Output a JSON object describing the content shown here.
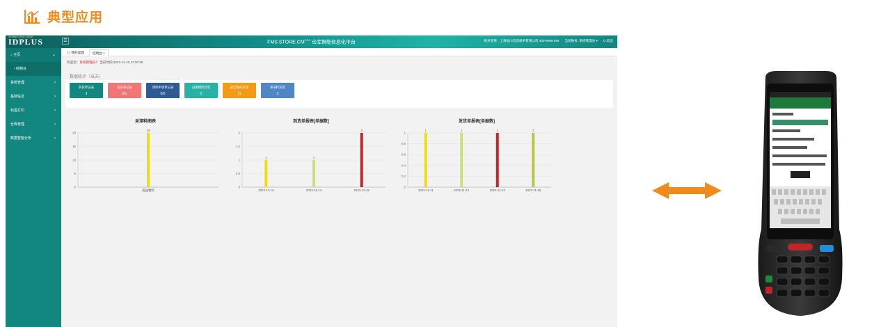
{
  "section": {
    "title": "典型应用",
    "icon": "bar-chart-icon",
    "color": "#f08a1c"
  },
  "app": {
    "logo": "IDPLUS",
    "logo_sub": "INTERNATIONAL GROUP",
    "menu_toggle": "☰",
    "title": "FMS.STORE.CM",
    "version": "V1.0",
    "subtitle": "仓库智能信息化平台",
    "tech_support": "技术支持：上海益川信息技术有限公司 400-6699-049",
    "account_label": "当前账号:",
    "account_name": "系统管理员 ▾",
    "logout": "⏻ 退出",
    "sidebar": [
      {
        "label": "⌂ 主页",
        "chev": "⌄",
        "kind": "home"
      },
      {
        "label": "› 控制台",
        "chev": "",
        "kind": "sub"
      },
      {
        "label": "系统管理",
        "chev": "›",
        "kind": "normal"
      },
      {
        "label": "基础信息",
        "chev": "›",
        "kind": "normal"
      },
      {
        "label": "标签打印",
        "chev": "›",
        "kind": "normal"
      },
      {
        "label": "仓库管理",
        "chev": "›",
        "kind": "normal"
      },
      {
        "label": "数据智能分析",
        "chev": "›",
        "kind": "normal"
      }
    ],
    "tabs": [
      {
        "label": "◯ 我的桌面"
      },
      {
        "label": "控制台  ×"
      }
    ],
    "welcome": {
      "prefix": "欢迎您：",
      "user": "系统管理员！",
      "time": "当前时间:2022-11-15 17:20:29"
    },
    "stat_title": "数据统计（当天）",
    "cards": [
      {
        "label": "到货单记录",
        "value": "3",
        "color": "#12877f"
      },
      {
        "label": "发货单记录",
        "value": "0/1",
        "color": "#f27676"
      },
      {
        "label": "领料申请单记录",
        "value": "0/0",
        "color": "#2e5a96"
      },
      {
        "label": "过期物料异常",
        "value": "0",
        "color": "#26b3a5"
      },
      {
        "label": "安全库存异常",
        "value": "11",
        "color": "#f59a14"
      },
      {
        "label": "呆滞料异常",
        "value": "2",
        "color": "#4f86c6"
      }
    ]
  },
  "chart_data": [
    {
      "type": "bar",
      "title": "呆滞料图表",
      "categories": [
        "成品物料"
      ],
      "values": [
        20
      ],
      "ylim": [
        0,
        20
      ],
      "yticks": [
        0,
        5,
        10,
        15,
        20
      ],
      "colors": [
        "#f0dc14"
      ],
      "grid": true
    },
    {
      "type": "bar",
      "title": "到货单报表[单据数]",
      "categories": [
        "2022-11-13",
        "2022-11-14",
        "2022-11-15"
      ],
      "values": [
        1,
        1,
        2
      ],
      "ylim": [
        0,
        2
      ],
      "yticks": [
        0,
        0.5,
        1,
        1.5,
        2
      ],
      "colors": [
        "#f0dc14",
        "#c8e07a",
        "#c0252a"
      ],
      "grid": true
    },
    {
      "type": "bar",
      "title": "发货单报表[单据数]",
      "categories": [
        "2022-11-11",
        "2022-11-12",
        "2022-11-13",
        "2022-11-15"
      ],
      "values": [
        1,
        1,
        1,
        1
      ],
      "ylim": [
        0,
        1
      ],
      "yticks": [
        0,
        0.2,
        0.4,
        0.6,
        0.8,
        1
      ],
      "colors": [
        "#f0dc14",
        "#c8e07a",
        "#c0252a",
        "#b7c644"
      ],
      "grid": true
    }
  ],
  "arrow": {
    "icon": "double-arrow-icon",
    "color": "#f08a1c"
  },
  "device": {
    "icon": "handheld-scanner-icon"
  }
}
